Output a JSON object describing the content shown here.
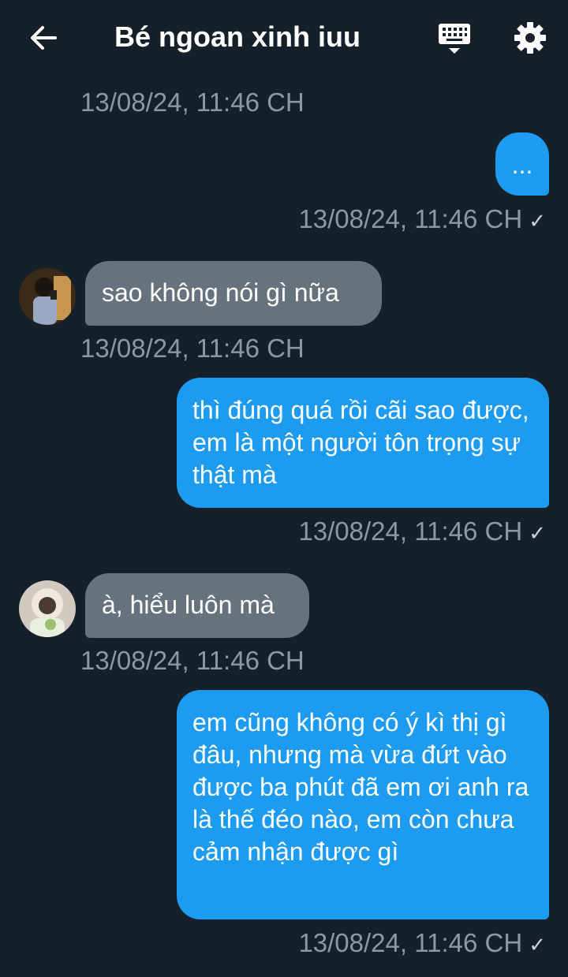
{
  "header": {
    "title": "Bé ngoan xinh iuu",
    "back_icon": "arrow-left-icon",
    "keyboard_icon": "keyboard-icon",
    "settings_icon": "gear-icon"
  },
  "colors": {
    "background": "#15202b",
    "outgoing_bubble": "#1d9bf0",
    "incoming_bubble": "#66727e",
    "timestamp": "#8b98a5"
  },
  "messages": [
    {
      "direction": "in",
      "timestamp": "13/08/24, 11:46 CH"
    },
    {
      "direction": "out",
      "text": "...",
      "timestamp": "13/08/24, 11:46 CH",
      "status": "✓"
    },
    {
      "direction": "in",
      "text": "sao không nói gì nữa",
      "timestamp": "13/08/24, 11:46 CH"
    },
    {
      "direction": "out",
      "text": "thì đúng quá rồi cãi sao được, em là một người tôn trọng sự thật mà",
      "timestamp": "13/08/24, 11:46 CH",
      "status": "✓"
    },
    {
      "direction": "in",
      "text": "à, hiểu luôn mà",
      "timestamp": "13/08/24, 11:46 CH"
    },
    {
      "direction": "out",
      "text": "em cũng không có ý kì thị gì đâu, nhưng mà vừa đứt vào được ba phút đã em ơi anh ra là thế đéo nào, em còn chưa cảm nhận được gì",
      "timestamp": "13/08/24, 11:46 CH",
      "status": "✓"
    }
  ]
}
